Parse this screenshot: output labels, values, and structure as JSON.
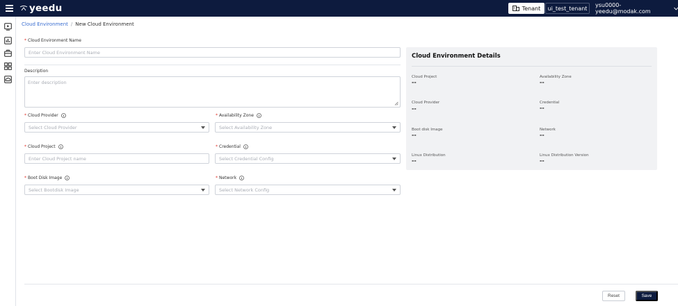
{
  "header": {
    "app_name": "yeedu",
    "tenant_button_label": "Tenant",
    "tenant_name": "ui_test_tenant",
    "user_email": "ysu0000-yeedu@modak.com"
  },
  "breadcrumb": {
    "parent": "Cloud Environment",
    "separator": "/",
    "current": "New Cloud Environment"
  },
  "form": {
    "required_mark": "*",
    "name": {
      "label": "Cloud Environment Name",
      "placeholder": "Enter Cloud Environment Name"
    },
    "description": {
      "label": "Description",
      "placeholder": "Enter description"
    },
    "cloud_provider": {
      "label": "Cloud Provider",
      "placeholder": "Select Cloud Provider"
    },
    "availability_zone": {
      "label": "Availability Zone",
      "placeholder": "Select Availability Zone"
    },
    "cloud_project": {
      "label": "Cloud Project",
      "placeholder": "Enter Cloud Project name"
    },
    "credential": {
      "label": "Credential",
      "placeholder": "Select Credential Config"
    },
    "boot_disk_image": {
      "label": "Boot Disk Image",
      "placeholder": "Select Bootdisk Image"
    },
    "network": {
      "label": "Network",
      "placeholder": "Select Network Config"
    }
  },
  "details": {
    "title": "Cloud Environment Details",
    "items": [
      {
        "label": "Cloud Project",
        "value": "--"
      },
      {
        "label": "Availability Zone",
        "value": "--"
      },
      {
        "label": "Cloud Provider",
        "value": "--"
      },
      {
        "label": "Credential",
        "value": "--"
      },
      {
        "label": "Boot disk Image",
        "value": "--"
      },
      {
        "label": "Network",
        "value": "--"
      },
      {
        "label": "Linux Distribution",
        "value": "--"
      },
      {
        "label": "Linux Distribution Version",
        "value": "--"
      }
    ]
  },
  "footer": {
    "reset_label": "Reset",
    "save_label": "Save"
  },
  "colors": {
    "header_bg": "#0d1b3e",
    "link": "#3b6fd1",
    "required": "#e0322a",
    "panel_bg": "#f1f2f4"
  }
}
